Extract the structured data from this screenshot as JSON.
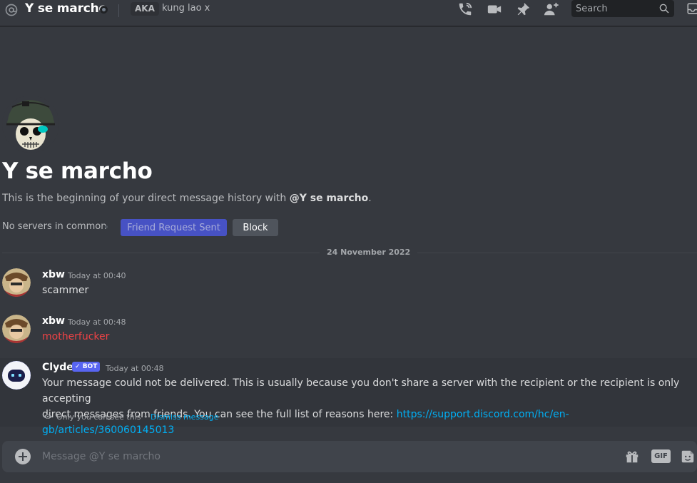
{
  "header": {
    "title": "Y se marcho",
    "aka_label": "AKA",
    "aka_name": "kung lao x",
    "search_placeholder": "Search"
  },
  "icons": {
    "at": "at-sign-icon",
    "status": "status-offline-icon",
    "call": "phone-call-icon",
    "video": "video-camera-icon",
    "pin": "pin-icon",
    "add_friend": "add-friend-icon",
    "search": "search-icon",
    "inbox": "inbox-icon",
    "plus": "plus-circle-icon",
    "gift": "gift-icon",
    "gif": "gif-icon",
    "sticker": "sticker-icon",
    "eye": "eye-icon"
  },
  "welcome": {
    "name": "Y se marcho",
    "subtitle_prefix": "This is the beginning of your direct message history with ",
    "subtitle_mention": "@Y se marcho",
    "subtitle_suffix": ".",
    "mutual_servers": "No servers in common",
    "friend_button": "Friend Request Sent",
    "block_button": "Block"
  },
  "date_divider": "24 November 2022",
  "messages": [
    {
      "author": "xbw",
      "time": "Today at 00:40",
      "text": "scammer"
    },
    {
      "author": "xbw",
      "time": "Today at 00:48",
      "text": "motherfucker"
    },
    {
      "author": "Clyde",
      "bot_tag": "BOT",
      "time": "Today at 00:48",
      "text_line1": "Your message could not be delivered. This is usually because you don't share a server with the recipient or the recipient is only accepting",
      "text_line2": "direct messages from friends. You can see the full list of reasons here: ",
      "link": "https://support.discord.com/hc/en-gb/articles/360060145013",
      "ephemeral_note": "Only you can see this • ",
      "dismiss": "Dismiss message"
    }
  ],
  "composer": {
    "placeholder": "Message @Y se marcho",
    "gif_label": "GIF"
  },
  "colors": {
    "background": "#36393f",
    "blurple": "#5865f2",
    "link": "#00aff4",
    "error_red": "#ed4245"
  }
}
